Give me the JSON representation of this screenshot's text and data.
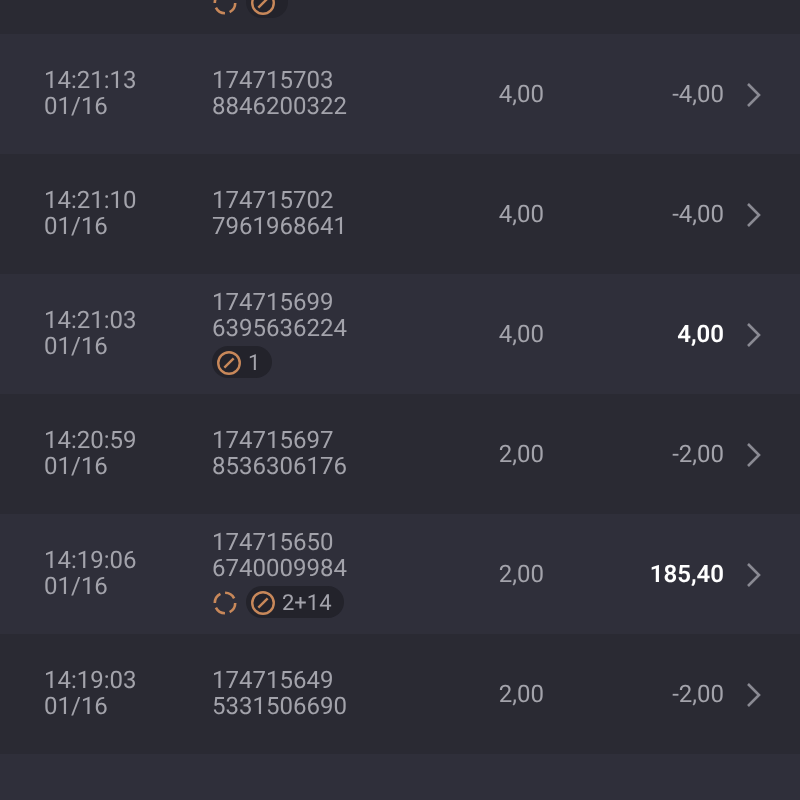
{
  "rows": [
    {
      "badges": [
        {
          "kind": "spinner"
        },
        {
          "kind": "coin"
        }
      ]
    },
    {
      "time": "14:21:13",
      "date": "01/16",
      "ids": [
        "174715703",
        "8846200322"
      ],
      "stake": "4,00",
      "result": "-4,00",
      "win": false
    },
    {
      "time": "14:21:10",
      "date": "01/16",
      "ids": [
        "174715702",
        "7961968641"
      ],
      "stake": "4,00",
      "result": "-4,00",
      "win": false
    },
    {
      "time": "14:21:03",
      "date": "01/16",
      "ids": [
        "174715699",
        "6395636224"
      ],
      "badges": [
        {
          "kind": "coin",
          "text": "1"
        }
      ],
      "stake": "4,00",
      "result": "4,00",
      "win": true
    },
    {
      "time": "14:20:59",
      "date": "01/16",
      "ids": [
        "174715697",
        "8536306176"
      ],
      "stake": "2,00",
      "result": "-2,00",
      "win": false
    },
    {
      "time": "14:19:06",
      "date": "01/16",
      "ids": [
        "174715650",
        "6740009984"
      ],
      "badges": [
        {
          "kind": "spinner"
        },
        {
          "kind": "coin",
          "text": "2+14"
        }
      ],
      "stake": "2,00",
      "result": "185,40",
      "win": true
    },
    {
      "time": "14:19:03",
      "date": "01/16",
      "ids": [
        "174715649",
        "5331506690"
      ],
      "stake": "2,00",
      "result": "-2,00",
      "win": false
    },
    {}
  ]
}
